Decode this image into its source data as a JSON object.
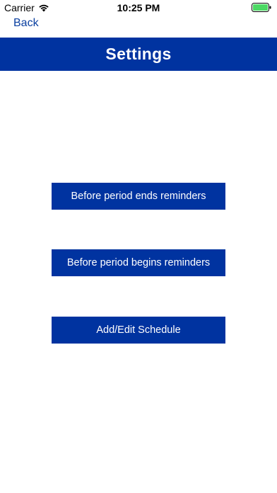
{
  "status_bar": {
    "carrier": "Carrier",
    "time": "10:25 PM",
    "wifi_icon": "wifi-icon",
    "battery_icon": "battery-icon",
    "battery_color": "#4cd964"
  },
  "nav": {
    "back_label": "Back"
  },
  "header": {
    "title": "Settings",
    "background_color": "#0033a0"
  },
  "buttons": [
    {
      "label": "Before period ends reminders"
    },
    {
      "label": "Before period begins reminders"
    },
    {
      "label": "Add/Edit Schedule"
    }
  ],
  "colors": {
    "accent": "#0033a0",
    "link": "#0a3fa0"
  }
}
